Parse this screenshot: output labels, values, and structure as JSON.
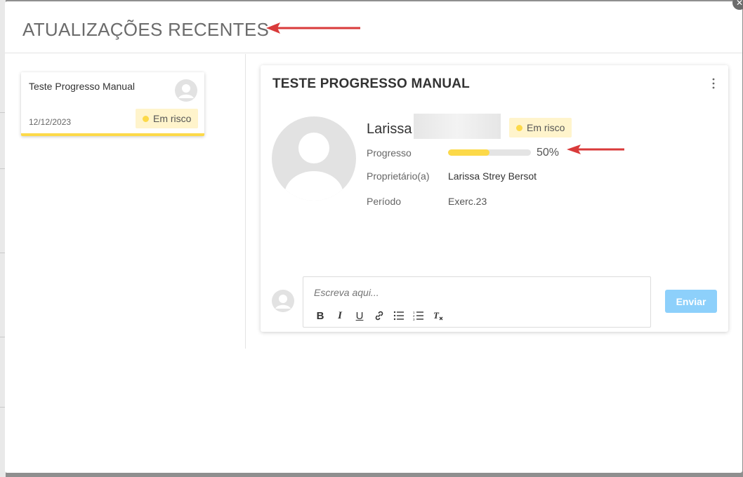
{
  "modal": {
    "title": "ATUALIZAÇÕES RECENTES",
    "close_icon": "close-icon"
  },
  "update_card": {
    "title": "Teste Progresso Manual",
    "date": "12/12/2023",
    "status": "Em risco",
    "status_color": "#fcd949"
  },
  "detail": {
    "title": "TESTE PROGRESSO MANUAL",
    "person_first_name": "Larissa",
    "status": "Em risco",
    "fields": {
      "progress_label": "Progresso",
      "progress_percent": 50,
      "progress_text": "50%",
      "owner_label": "Proprietário(a)",
      "owner_value": "Larissa Strey Bersot",
      "period_label": "Período",
      "period_value": "Exerc.23"
    }
  },
  "comment": {
    "placeholder": "Escreva aqui...",
    "toolbar": [
      {
        "name": "bold",
        "glyph": "B"
      },
      {
        "name": "italic",
        "glyph": "I"
      },
      {
        "name": "underline",
        "glyph": "U"
      },
      {
        "name": "link",
        "glyph": "🔗"
      },
      {
        "name": "bullet-list",
        "glyph": "☰"
      },
      {
        "name": "numbered-list",
        "glyph": "☷"
      },
      {
        "name": "clear-format",
        "glyph": "T"
      }
    ],
    "send_label": "Enviar"
  },
  "colors": {
    "accent_yellow": "#fcd949",
    "badge_bg": "#fff4cc",
    "send_button": "#8dd0fb",
    "annotation_arrow": "#d93a3a"
  }
}
